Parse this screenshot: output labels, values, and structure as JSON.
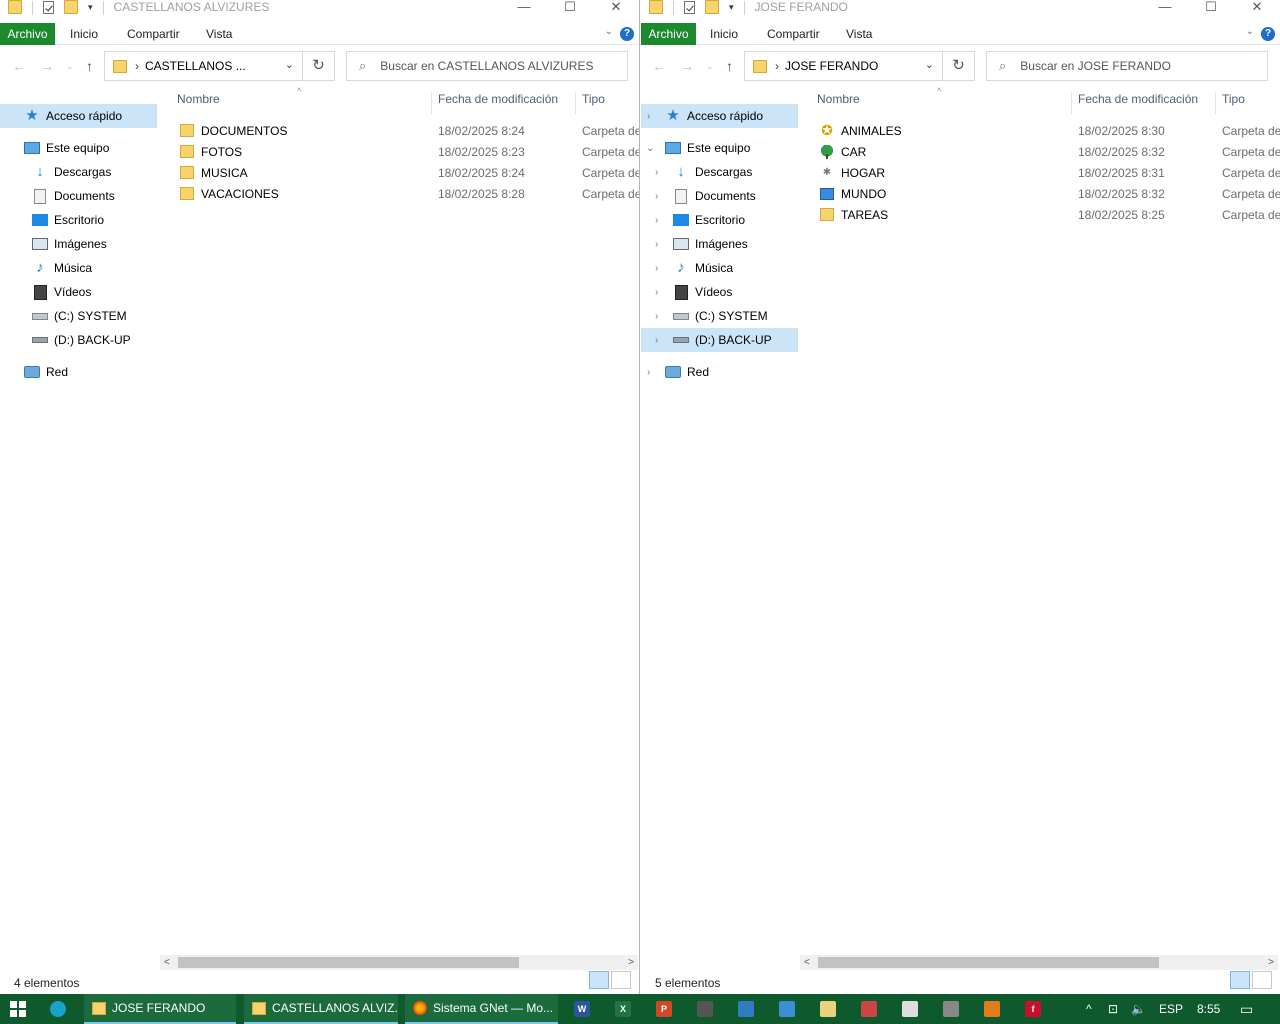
{
  "windows": {
    "left": {
      "title": "CASTELLANOS ALVIZURES",
      "ribbon": {
        "file": "Archivo",
        "home": "Inicio",
        "share": "Compartir",
        "view": "Vista"
      },
      "address": "CASTELLANOS ...",
      "search_placeholder": "Buscar en CASTELLANOS ALVIZURES",
      "columns": {
        "name": "Nombre",
        "date": "Fecha de modificación",
        "type": "Tipo"
      },
      "files": [
        {
          "name": "DOCUMENTOS",
          "date": "18/02/2025 8:24",
          "type": "Carpeta de"
        },
        {
          "name": "FOTOS",
          "date": "18/02/2025 8:23",
          "type": "Carpeta de"
        },
        {
          "name": "MUSICA",
          "date": "18/02/2025 8:24",
          "type": "Carpeta de"
        },
        {
          "name": "VACACIONES",
          "date": "18/02/2025 8:28",
          "type": "Carpeta de"
        }
      ],
      "status": "4 elementos"
    },
    "right": {
      "title": "JOSE FERANDO",
      "ribbon": {
        "file": "Archivo",
        "home": "Inicio",
        "share": "Compartir",
        "view": "Vista"
      },
      "address": "JOSE FERANDO",
      "search_placeholder": "Buscar en JOSE FERANDO",
      "columns": {
        "name": "Nombre",
        "date": "Fecha de modificación",
        "type": "Tipo"
      },
      "files": [
        {
          "name": "ANIMALES",
          "date": "18/02/2025 8:30",
          "type": "Carpeta de"
        },
        {
          "name": "CAR",
          "date": "18/02/2025 8:32",
          "type": "Carpeta de"
        },
        {
          "name": "HOGAR",
          "date": "18/02/2025 8:31",
          "type": "Carpeta de"
        },
        {
          "name": "MUNDO",
          "date": "18/02/2025 8:32",
          "type": "Carpeta de"
        },
        {
          "name": "TAREAS",
          "date": "18/02/2025 8:25",
          "type": "Carpeta de"
        }
      ],
      "status": "5 elementos"
    }
  },
  "navpane": {
    "quick_access": "Acceso rápido",
    "this_pc": "Este equipo",
    "downloads": "Descargas",
    "documents": "Documents",
    "desktop": "Escritorio",
    "pictures": "Imágenes",
    "music": "Música",
    "videos": "Vídeos",
    "drive_c": "(C:) SYSTEM",
    "drive_d": "(D:) BACK-UP",
    "network": "Red"
  },
  "taskbar": {
    "items": [
      {
        "label": "JOSE FERANDO"
      },
      {
        "label": "CASTELLANOS ALVIZ..."
      },
      {
        "label": "Sistema GNet — Mo..."
      }
    ],
    "language": "ESP",
    "time": "8:55"
  },
  "colors": {
    "accent": "#1a8a2c",
    "taskbar": "#0e5a2d",
    "selection": "#cce4f7"
  }
}
